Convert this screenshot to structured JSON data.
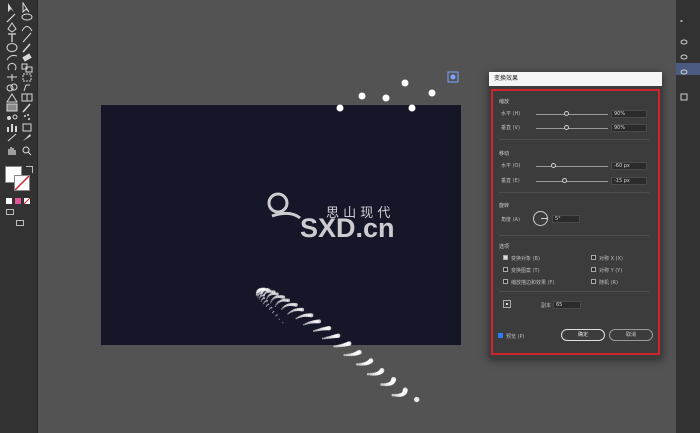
{
  "dialog": {
    "title": "变换效果",
    "scale": {
      "heading": "缩放",
      "horizontal_label": "水平 (H)",
      "horizontal_value": "90%",
      "vertical_label": "垂直 (V)",
      "vertical_value": "90%"
    },
    "move": {
      "heading": "移动",
      "horizontal_label": "水平 (O)",
      "horizontal_value": "-60 px",
      "vertical_label": "垂直 (E)",
      "vertical_value": "-15 px"
    },
    "rotate": {
      "heading": "旋转",
      "angle_label": "角度 (A)",
      "angle_value": "5°"
    },
    "options": {
      "heading": "选项",
      "items": [
        {
          "label": "变换对象 (B)",
          "checked": true
        },
        {
          "label": "对称 X (X)",
          "checked": false
        },
        {
          "label": "变换图案 (T)",
          "checked": false
        },
        {
          "label": "对称 Y (Y)",
          "checked": false
        },
        {
          "label": "缩放描边和效果 (F)",
          "checked": false
        },
        {
          "label": "随机 (R)",
          "checked": false
        }
      ]
    },
    "copies_label": "副本",
    "copies_value": "65",
    "preview_label": "预览 (P)",
    "ok_label": "确定",
    "cancel_label": "取消"
  },
  "watermark": {
    "logo_text": "SXD.cn",
    "tagline": "思 山 现 代"
  },
  "colors": {
    "artboard": "#161629",
    "highlight_frame": "#d0242b",
    "accent_blue": "#2f7bf5"
  }
}
